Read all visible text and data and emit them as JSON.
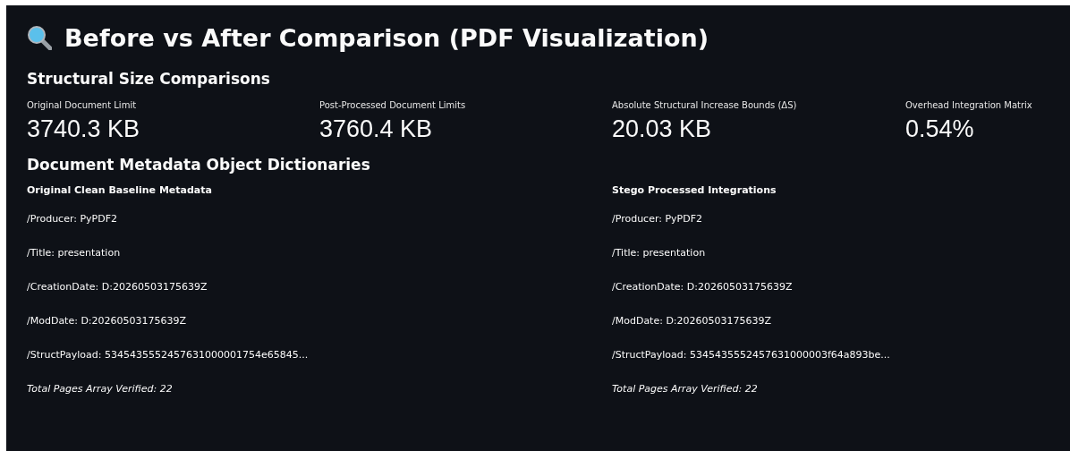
{
  "title": "Before vs After Comparison (PDF Visualization)",
  "size_section": {
    "heading": "Structural Size Comparisons",
    "metrics": [
      {
        "label": "Original Document Limit",
        "value": "3740.3 KB"
      },
      {
        "label": "Post-Processed Document Limits",
        "value": "3760.4 KB"
      },
      {
        "label": "Absolute Structural Increase Bounds (ΔS)",
        "value": "20.03 KB"
      },
      {
        "label": "Overhead Integration Matrix",
        "value": "0.54%"
      }
    ]
  },
  "metadata_section": {
    "heading": "Document Metadata Object Dictionaries",
    "columns": [
      {
        "heading": "Original Clean Baseline Metadata",
        "lines": [
          {
            "kind": "entry",
            "text": "/Producer: PyPDF2"
          },
          {
            "kind": "entry",
            "text": "/Title: presentation"
          },
          {
            "kind": "entry",
            "text": "/CreationDate: D:20260503175639Z"
          },
          {
            "kind": "entry",
            "text": "/ModDate: D:20260503175639Z"
          },
          {
            "kind": "entry",
            "text": "/StructPayload: 5345435552457631000001754e65845..."
          },
          {
            "kind": "summary",
            "text": "Total Pages Array Verified: 22"
          }
        ]
      },
      {
        "heading": "Stego Processed Integrations",
        "lines": [
          {
            "kind": "entry",
            "text": "/Producer: PyPDF2"
          },
          {
            "kind": "entry",
            "text": "/Title: presentation"
          },
          {
            "kind": "entry",
            "text": "/CreationDate: D:20260503175639Z"
          },
          {
            "kind": "entry",
            "text": "/ModDate: D:20260503175639Z"
          },
          {
            "kind": "entry",
            "text": "/StructPayload: 5345435552457631000003f64a893be..."
          },
          {
            "kind": "summary",
            "text": "Total Pages Array Verified: 22"
          }
        ]
      }
    ]
  }
}
